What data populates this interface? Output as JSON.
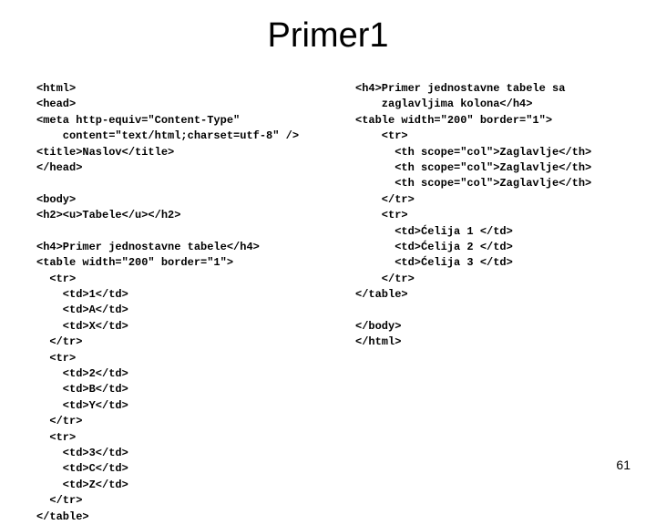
{
  "title": "Primer1",
  "slide_number": "61",
  "code_left": "<html>\n<head>\n<meta http-equiv=\"Content-Type\"\n    content=\"text/html;charset=utf-8\" />\n<title>Naslov</title>\n</head>\n\n<body>\n<h2><u>Tabele</u></h2>\n\n<h4>Primer jednostavne tabele</h4>\n<table width=\"200\" border=\"1\">\n  <tr>\n    <td>1</td>\n    <td>A</td>\n    <td>X</td>\n  </tr>\n  <tr>\n    <td>2</td>\n    <td>B</td>\n    <td>Y</td>\n  </tr>\n  <tr>\n    <td>3</td>\n    <td>C</td>\n    <td>Z</td>\n  </tr>\n</table>",
  "code_right": "<h4>Primer jednostavne tabele sa\n    zaglavljima kolona</h4>\n<table width=\"200\" border=\"1\">\n    <tr>\n      <th scope=\"col\">Zaglavlje</th>\n      <th scope=\"col\">Zaglavlje</th>\n      <th scope=\"col\">Zaglavlje</th>\n    </tr>\n    <tr>\n      <td>Ćelija 1 </td>\n      <td>Ćelija 2 </td>\n      <td>Ćelija 3 </td>\n    </tr>\n</table>\n\n</body>\n</html>"
}
